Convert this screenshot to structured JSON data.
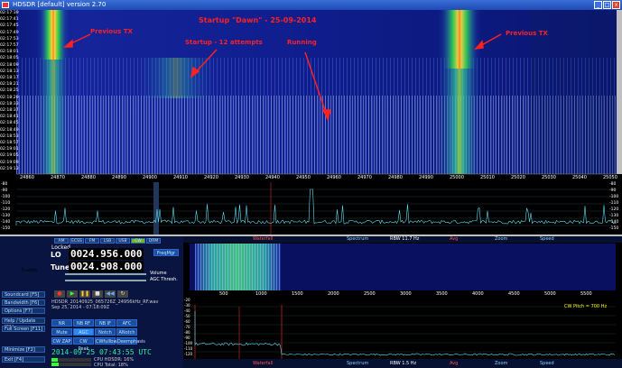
{
  "window": {
    "title": "HDSDR [default]  version 2.70"
  },
  "annotations": {
    "title": "Startup \"Dawn\" - 25-09-2014",
    "previous_tx1": "Previous TX",
    "startup_attempts": "Startup - 12 attempts",
    "running": "Running",
    "previous_tx2": "Previous TX"
  },
  "waterfall_times": [
    "02:17:39",
    "02:17:41",
    "02:17:45",
    "02:17:49",
    "02:17:53",
    "02:17:57",
    "02:18:01",
    "02:18:05",
    "02:18:09",
    "02:18:13",
    "02:18:17",
    "02:18:21",
    "02:18:25",
    "02:18:29",
    "02:18:33",
    "02:18:37",
    "02:18:41",
    "02:18:45",
    "02:18:49",
    "02:18:53",
    "02:18:57",
    "02:19:01",
    "02:19:05",
    "02:19:09",
    "02:19:13"
  ],
  "freq_axis": [
    "24860",
    "24870",
    "24880",
    "24890",
    "24900",
    "24910",
    "24920",
    "24930",
    "24940",
    "24950",
    "24960",
    "24970",
    "24980",
    "24990",
    "25000",
    "25010",
    "25020",
    "25030",
    "25040",
    "25050"
  ],
  "db_axis": [
    "-80",
    "-90",
    "-100",
    "-110",
    "-120",
    "-130",
    "-140",
    "-150"
  ],
  "db_axis_right": [
    "-80",
    "-90",
    "-100",
    "-110",
    "-120",
    "-130",
    "-140",
    "-150"
  ],
  "controls": {
    "locked": "Locked",
    "lo_label": "LO",
    "lo_freq": "0024.956.000",
    "tune_label": "Tune",
    "tune_freq": "0024.908.000",
    "freq_mgr": "FreqMgr",
    "volume": "Volume",
    "agc_thresh": "AGC Thresh.",
    "filename": "HDSDR_20140925_065726Z_24956kHz_RF.wav",
    "file_date": "Sep 25, 2014 - 07:18:09Z",
    "date_time": "2014-09-25   07:43:55 UTC",
    "cpu_hdsdr": "CPU HDSDR: 16%",
    "cpu_total": "CPU Total: 18%",
    "smeter_label": "S-units"
  },
  "left_buttons": [
    "Soundcard [F5]",
    "Bandwidth [F6]",
    "Options [F7]",
    "Help / Update [F1]",
    "Full Screen [F11]",
    "Minimize [F2]",
    "Exit [F4]"
  ],
  "mode_buttons": [
    "NR",
    "NB RF",
    "NB IF",
    "AFC",
    "Mute",
    "AGC Fast",
    "Notch",
    "ANotch",
    "CW ZAP",
    "CW Peak",
    "CWfullbw",
    "Deemphasis"
  ],
  "mode_top": [
    "AM",
    "ECSS",
    "FM",
    "LSB",
    "USB",
    "CW",
    "DRM"
  ],
  "toolbar_top": {
    "waterfall": "Waterfall",
    "spectrum": "Spectrum",
    "rbw": "RBW 11.7 Hz",
    "avg": "Avg",
    "zoom": "Zoom",
    "speed": "Speed"
  },
  "toolbar_bottom": {
    "waterfall": "Waterfall",
    "spectrum": "Spectrum",
    "rbw": "RBW 1.5 Hz",
    "avg": "Avg",
    "zoom": "Zoom",
    "speed": "Speed"
  },
  "af_axis": [
    "500",
    "1000",
    "1500",
    "2000",
    "2500",
    "3000",
    "3500",
    "4000",
    "4500",
    "5000",
    "5500"
  ],
  "af_db": [
    "-20",
    "-30",
    "-40",
    "-50",
    "-60",
    "-70",
    "-80",
    "-90",
    "-100",
    "-110",
    "-120"
  ],
  "cw_pitch": "CW Pitch = 700 Hz",
  "colors": {
    "accent": "#ff2020",
    "panel": "#0a1440",
    "freq_text": "#ffffff"
  }
}
